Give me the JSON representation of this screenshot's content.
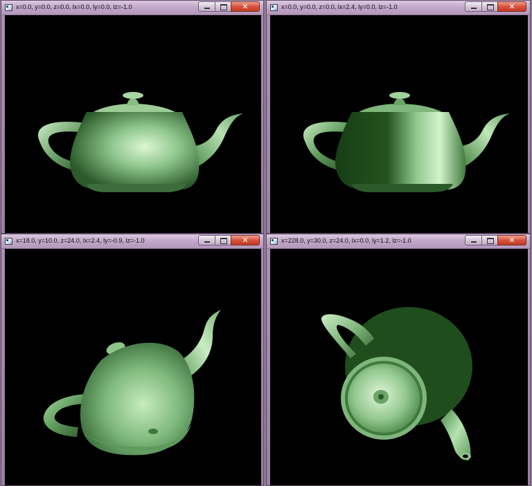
{
  "windows": [
    {
      "title": "x=0.0, y=0.0, z=0.0, lx=0.0, ly=0.0, lz=-1.0"
    },
    {
      "title": "x=0.0, y=0.0, z=0.0, lx=2.4, ly=0.0, lz=-1.0"
    },
    {
      "title": "x=18.0, y=10.0, z=24.0, lx=2.4, ly=-0.9, lz=-1.0"
    },
    {
      "title": "x=228.0, y=30.0, z=24.0, lx=0.0, ly=1.2, lz=-1.0"
    }
  ],
  "controls": {
    "minimize": "",
    "maximize": "",
    "close": "✕"
  },
  "colors": {
    "background": "#000000",
    "teapot_highlight": "#d8f5d0",
    "teapot_mid": "#6fa870",
    "teapot_shadow": "#1f4a1c",
    "titlebar": "#c4a9cb",
    "close_button": "#d8523b"
  }
}
